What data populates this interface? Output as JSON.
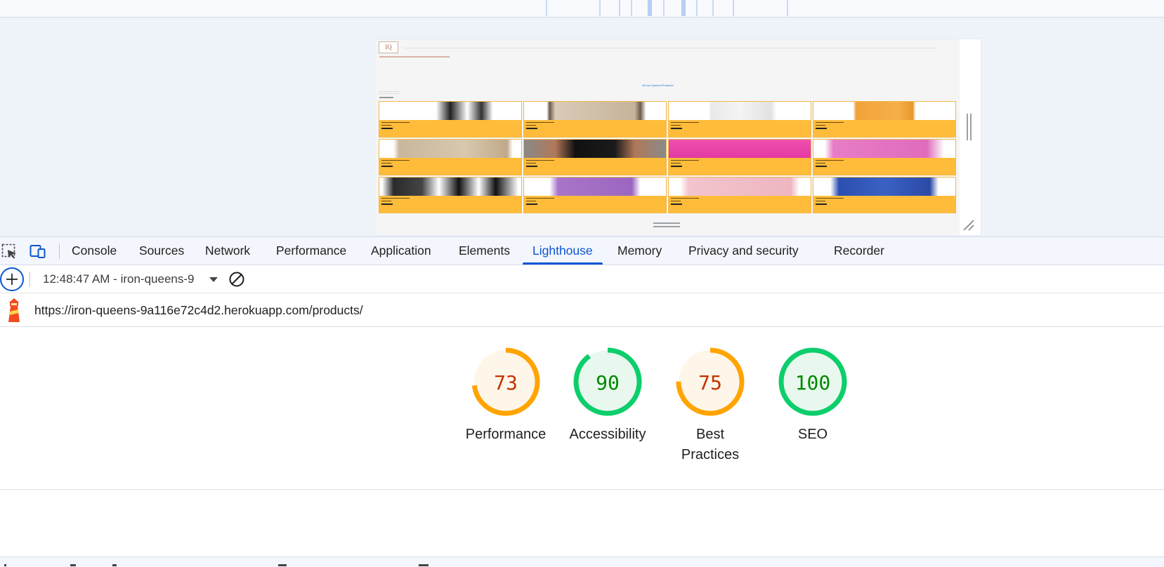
{
  "preview": {
    "mini_heading": "All Iron Queens Products"
  },
  "tabs": {
    "items": [
      {
        "label": "Console"
      },
      {
        "label": "Sources"
      },
      {
        "label": "Network"
      },
      {
        "label": "Performance"
      },
      {
        "label": "Application"
      },
      {
        "label": "Elements"
      },
      {
        "label": "Lighthouse",
        "active": true
      },
      {
        "label": "Memory"
      },
      {
        "label": "Privacy and security"
      },
      {
        "label": "Recorder"
      }
    ]
  },
  "toolbar": {
    "report_label": "12:48:47 AM - iron-queens-9"
  },
  "report": {
    "url": "https://iron-queens-9a116e72c4d2.herokuapp.com/products/"
  },
  "scores": [
    {
      "value": "73",
      "label": "Performance",
      "status": "average"
    },
    {
      "value": "90",
      "label": "Accessibility",
      "status": "pass"
    },
    {
      "value": "75",
      "label": "Best Practices",
      "status": "average"
    },
    {
      "value": "100",
      "label": "SEO",
      "status": "pass"
    }
  ],
  "colors": {
    "accent": "#0b57d0",
    "average_ring": "#ffa400",
    "average_text": "#c33300",
    "average_fill": "#fff6ea",
    "pass_ring": "#0cce6b",
    "pass_text": "#008800",
    "pass_fill": "#e8f8ee",
    "card_orange": "#ffbc3a"
  },
  "icons": {
    "inspect": "inspect-element-icon",
    "device": "device-toolbar-icon",
    "new_report": "plus-circle-icon",
    "clear": "clear-block-icon",
    "lighthouse": "lighthouse-logo-icon"
  }
}
